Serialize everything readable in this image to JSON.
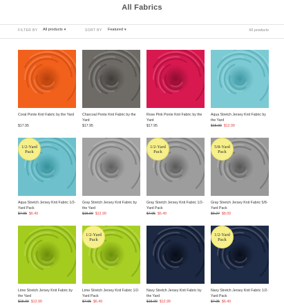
{
  "page": {
    "title": "All Fabrics"
  },
  "filter_bar": {
    "filter_label": "FILTER BY",
    "filter_value": "All products",
    "sort_label": "SORT BY",
    "sort_value": "Featured",
    "count": "66 products",
    "chevron_icon": "chevron-down-icon"
  },
  "products": [
    {
      "name": "Coral Ponte Knit Fabric by the Yard",
      "regular_price": "$17.95",
      "old_price": "",
      "sale_price": "",
      "badge": "",
      "color": "#f2611c",
      "shade": "#b5400c"
    },
    {
      "name": "Charcoal Ponte Knit Fabric by the Yard",
      "regular_price": "$17.95",
      "old_price": "",
      "sale_price": "",
      "badge": "",
      "color": "#6e6b66",
      "shade": "#3e3c39"
    },
    {
      "name": "Rose Pink Ponte Knit Fabric by the Yard",
      "regular_price": "$17.95",
      "old_price": "",
      "sale_price": "",
      "badge": "",
      "color": "#d8194f",
      "shade": "#8e0c31"
    },
    {
      "name": "Aqua Stretch Jersey Knit Fabric by the Yard",
      "regular_price": "",
      "old_price": "$15.90",
      "sale_price": "$12.99",
      "badge": "",
      "color": "#7ccad3",
      "shade": "#3f98a3"
    },
    {
      "name": "Aqua Stretch Jersey Knit Fabric 1/2-Yard Pack",
      "regular_price": "",
      "old_price": "$7.95",
      "sale_price": "$6.49",
      "badge": "1/2-Yard Pack",
      "color": "#6ec1cc",
      "shade": "#35909c"
    },
    {
      "name": "Gray Stretch Jersey Knit Fabric by the Yard",
      "regular_price": "",
      "old_price": "$15.90",
      "sale_price": "$12.99",
      "badge": "",
      "color": "#a3a3a3",
      "shade": "#5e5e5e"
    },
    {
      "name": "Gray Stretch Jersey Knit Fabric 1/2-Yard Pack",
      "regular_price": "",
      "old_price": "$7.95",
      "sale_price": "$6.49",
      "badge": "1/2-Yard Pack",
      "color": "#9d9d9d",
      "shade": "#585858"
    },
    {
      "name": "Gray Stretch Jersey Knit Fabric 5/8-Yard Pack",
      "regular_price": "",
      "old_price": "$9.27",
      "sale_price": "$8.09",
      "badge": "5/8-Yard Pack",
      "color": "#999999",
      "shade": "#555555"
    },
    {
      "name": "Lime Stretch Jersey Knit Fabric by the Yard",
      "regular_price": "",
      "old_price": "$15.90",
      "sale_price": "$12.99",
      "badge": "",
      "color": "#a3cc1f",
      "shade": "#6b8c0a"
    },
    {
      "name": "Lime Stretch Jersey Knit Fabric 1/2-Yard Pack",
      "regular_price": "",
      "old_price": "$7.95",
      "sale_price": "$6.49",
      "badge": "1/2-Yard Pack",
      "color": "#a8d024",
      "shade": "#6b8f0c"
    },
    {
      "name": "Navy Stretch Jersey Knit Fabric by the Yard",
      "regular_price": "",
      "old_price": "$15.90",
      "sale_price": "$12.99",
      "badge": "",
      "color": "#1d2943",
      "shade": "#070c17"
    },
    {
      "name": "Navy Stretch Jersey Knit Fabric 1/2-Yard Pack",
      "regular_price": "",
      "old_price": "$7.95",
      "sale_price": "$6.49",
      "badge": "1/2-Yard Pack",
      "color": "#1f2c48",
      "shade": "#080d19"
    }
  ]
}
